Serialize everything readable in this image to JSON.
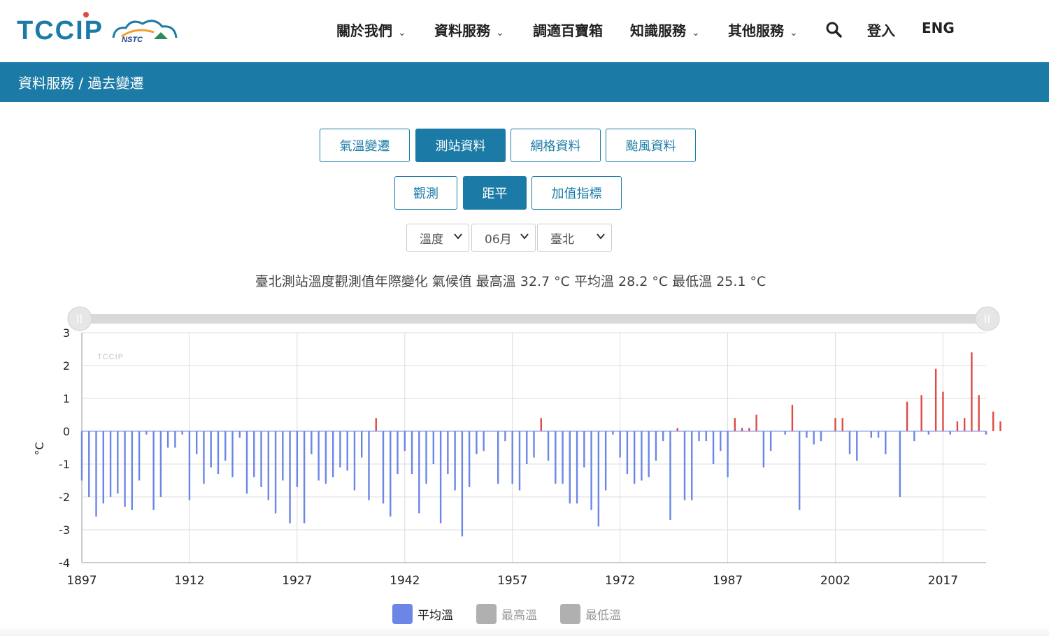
{
  "header": {
    "nav": [
      {
        "label": "關於我們",
        "dropdown": true
      },
      {
        "label": "資料服務",
        "dropdown": true
      },
      {
        "label": "調適百寶箱",
        "dropdown": false
      },
      {
        "label": "知識服務",
        "dropdown": true
      },
      {
        "label": "其他服務",
        "dropdown": true
      }
    ],
    "login_label": "登入",
    "lang_label": "ENG",
    "logo_text": "TCCIP",
    "logo_sub": "NSTC"
  },
  "breadcrumb": "資料服務 / 過去變遷",
  "tabs_primary": [
    {
      "label": "氣溫變遷",
      "active": false
    },
    {
      "label": "測站資料",
      "active": true
    },
    {
      "label": "網格資料",
      "active": false
    },
    {
      "label": "颱風資料",
      "active": false
    }
  ],
  "tabs_secondary": [
    {
      "label": "觀測",
      "active": false
    },
    {
      "label": "距平",
      "active": true
    },
    {
      "label": "加值指標",
      "active": false
    }
  ],
  "selects": {
    "variable": "溫度",
    "month": "06月",
    "station": "臺北"
  },
  "chart_title": "臺北測站溫度觀測值年際變化 氣候值 最高溫 32.7 °C 平均溫 28.2 °C 最低溫 25.1 °C",
  "colors": {
    "brand": "#1b7ba6",
    "negative": "#6b86e6",
    "positive": "#e04a45",
    "disabled": "#b0b0b0"
  },
  "chart_data": {
    "type": "bar",
    "title": "",
    "xlabel": "",
    "ylabel": "°C",
    "ylim": [
      -4,
      3
    ],
    "yticks": [
      3,
      2,
      1,
      0,
      -1,
      -2,
      -3,
      -4
    ],
    "xticks": [
      1897,
      1912,
      1927,
      1942,
      1957,
      1972,
      1987,
      2002,
      2017
    ],
    "watermark": "TCCIP",
    "grid": true,
    "legend_position": "bottom",
    "x_start": 1897,
    "x_end": 2023,
    "series": [
      {
        "name": "平均溫",
        "visible": true,
        "values": [
          -1.5,
          -2.0,
          -2.6,
          -2.2,
          -2.0,
          -1.9,
          -2.3,
          -2.4,
          -1.5,
          -0.1,
          -2.4,
          -2.0,
          -0.5,
          -0.5,
          -0.1,
          -2.1,
          -0.7,
          -1.6,
          -1.1,
          -1.3,
          -0.9,
          -1.4,
          -0.2,
          -1.9,
          -1.4,
          -1.7,
          -2.1,
          -2.5,
          -1.5,
          -2.8,
          -1.7,
          -2.8,
          -0.7,
          -1.5,
          -1.6,
          -1.4,
          -1.1,
          -1.2,
          -1.8,
          -0.8,
          -2.1,
          0.4,
          -2.2,
          -2.6,
          -1.3,
          -0.6,
          -1.3,
          -2.5,
          -1.6,
          -1.0,
          -2.8,
          -1.3,
          -1.8,
          -3.2,
          -1.7,
          -0.7,
          -0.6,
          null,
          -1.6,
          -0.3,
          -1.6,
          -1.8,
          -1.0,
          -0.8,
          0.4,
          -0.9,
          -1.6,
          -1.6,
          -2.2,
          -2.2,
          -1.1,
          -2.4,
          -2.9,
          -1.8,
          -0.1,
          -0.8,
          -1.3,
          -1.6,
          -1.5,
          -1.4,
          -0.9,
          -0.3,
          -2.7,
          0.1,
          -2.1,
          -2.1,
          -0.3,
          -0.3,
          -1.0,
          -0.6,
          -1.4,
          0.4,
          0.1,
          0.1,
          0.5,
          -1.1,
          -0.6,
          null,
          -0.1,
          0.8,
          -2.4,
          -0.2,
          -0.4,
          -0.3,
          null,
          0.4,
          0.4,
          -0.7,
          -0.9,
          null,
          -0.2,
          -0.2,
          -0.7,
          null,
          -2.0,
          0.9,
          -0.3,
          1.1,
          -0.1,
          1.9,
          1.2,
          -0.1,
          0.3,
          0.4,
          2.4,
          1.1,
          -0.1,
          0.6,
          0.3
        ]
      },
      {
        "name": "最高溫",
        "visible": false
      },
      {
        "name": "最低溫",
        "visible": false
      }
    ]
  }
}
